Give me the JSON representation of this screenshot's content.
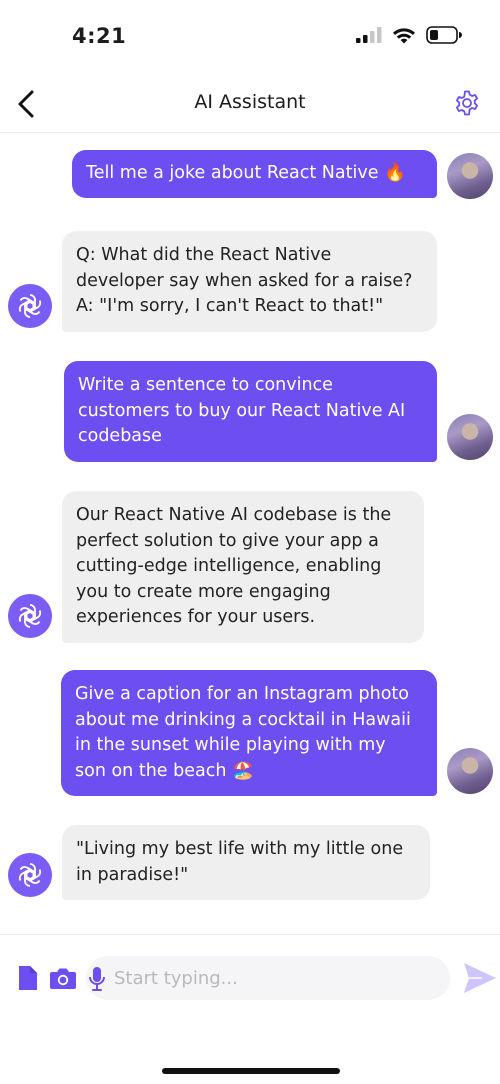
{
  "status_bar": {
    "time": "4:21"
  },
  "header": {
    "title": "AI Assistant"
  },
  "colors": {
    "accent": "#6d4ef0",
    "bot_bubble": "#efefef",
    "send_icon": "#cfc4fb"
  },
  "messages": [
    {
      "role": "user",
      "lines": [
        "Tell me a joke about React Native 🔥"
      ]
    },
    {
      "role": "assistant",
      "lines": [
        "Q: What did the React Native",
        "developer say when asked for a raise?",
        "A: \"I'm sorry, I can't React to that!\""
      ]
    },
    {
      "role": "user",
      "lines": [
        "Write a sentence to convince",
        "customers to buy our React Native AI",
        "codebase"
      ]
    },
    {
      "role": "assistant",
      "lines": [
        "Our React Native AI codebase is the",
        "perfect solution to give your app a",
        "cutting-edge intelligence, enabling",
        "you to create more engaging",
        "experiences for your users."
      ]
    },
    {
      "role": "user",
      "lines": [
        "Give a caption for an Instagram photo",
        "about me drinking a cocktail in Hawaii",
        "in the sunset while playing with my",
        "son on the beach 🏖️"
      ]
    },
    {
      "role": "assistant",
      "lines": [
        "\"Living my best life with my little one",
        "in paradise!\""
      ]
    }
  ],
  "input": {
    "placeholder": "Start typing..."
  },
  "icons": {
    "back": "chevron-left-icon",
    "settings": "gear-icon",
    "file": "file-icon",
    "camera": "camera-icon",
    "mic": "microphone-icon",
    "send": "send-icon",
    "bot_avatar": "openai-logo-icon",
    "signal": "signal-icon",
    "wifi": "wifi-icon",
    "battery": "battery-icon"
  }
}
